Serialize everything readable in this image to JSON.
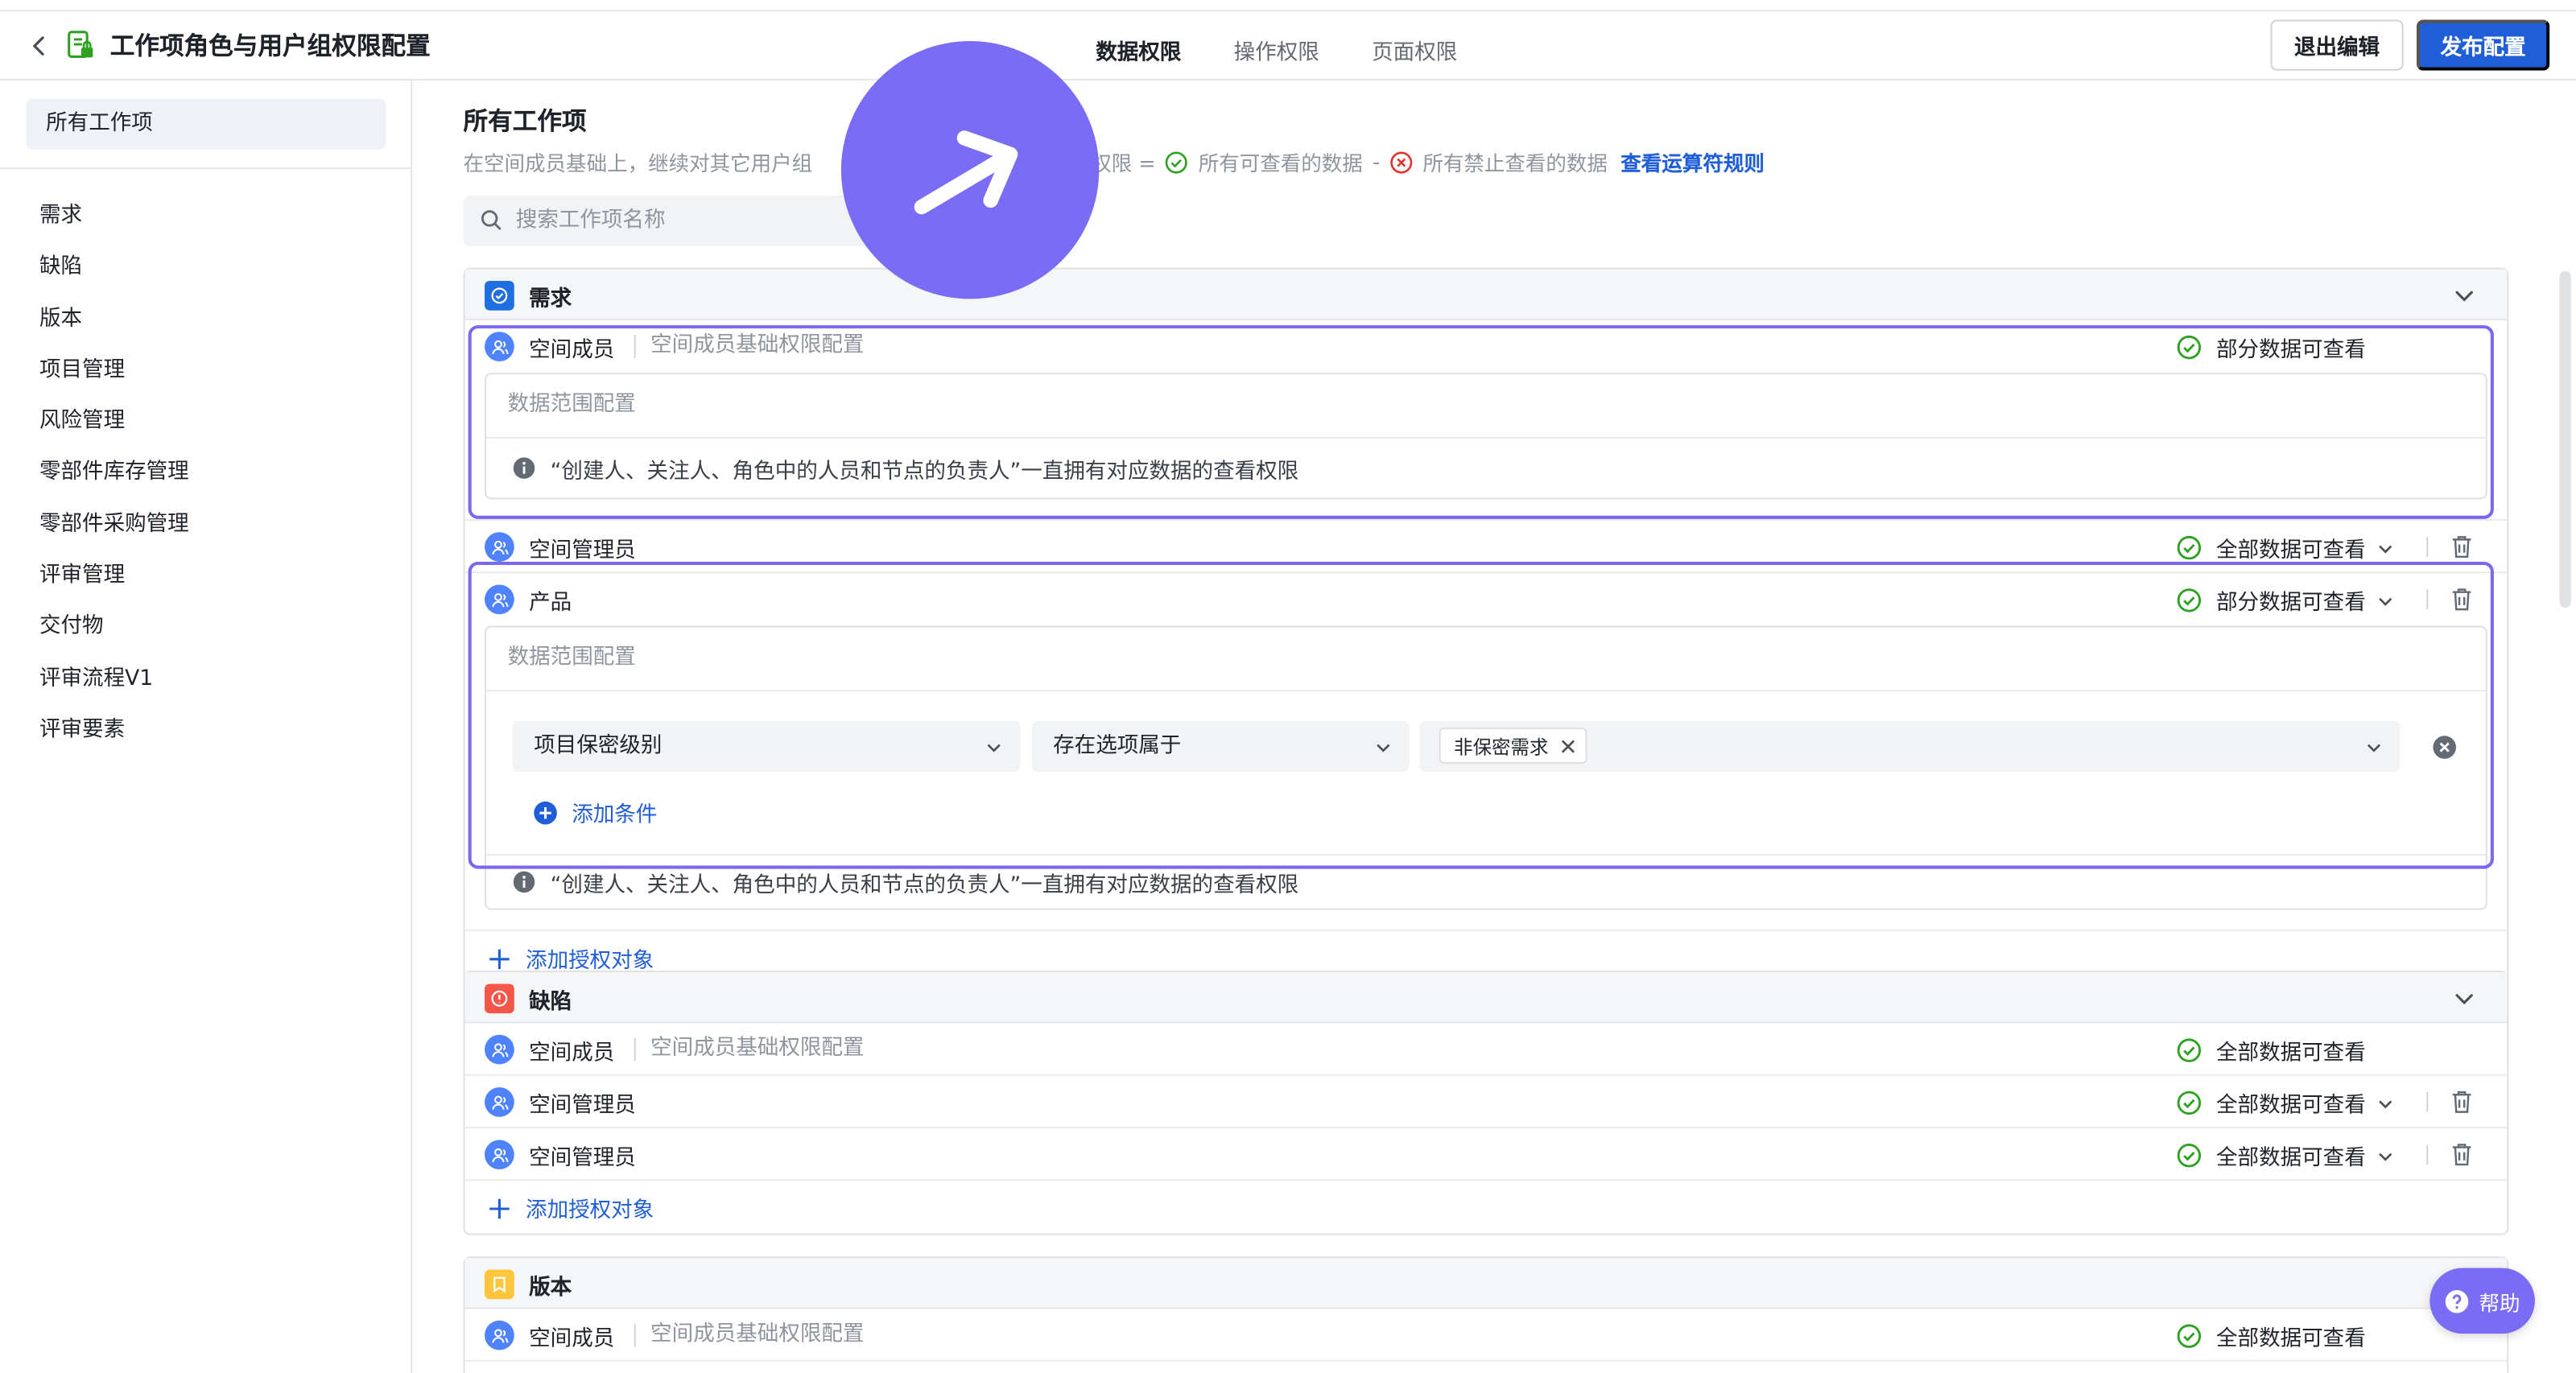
{
  "header": {
    "title": "工作项角色与用户组权限配置",
    "tabs": [
      {
        "label": "数据权限",
        "active": true
      },
      {
        "label": "操作权限",
        "active": false
      },
      {
        "label": "页面权限",
        "active": false
      }
    ],
    "exit_label": "退出编辑",
    "publish_label": "发布配置"
  },
  "sidebar": {
    "all_label": "所有工作项",
    "items": [
      "需求",
      "缺陷",
      "版本",
      "项目管理",
      "风险管理",
      "零部件库存管理",
      "零部件采购管理",
      "评审管理",
      "交付物",
      "评审流程V1",
      "评审要素"
    ]
  },
  "main": {
    "title": "所有工作项",
    "desc_prefix": "在空间成员基础上，继续对其它用户组",
    "desc_formula": "终权限 =",
    "desc_allowed": "所有可查看的数据",
    "desc_minus": "-",
    "desc_denied": "所有禁止查看的数据",
    "desc_link": "查看运算符规则",
    "search_placeholder": "搜索工作项名称"
  },
  "groups": {
    "req": {
      "name": "需求",
      "rows": {
        "member": {
          "name": "空间成员",
          "sub": "空间成员基础权限配置",
          "status": "部分数据可查看"
        },
        "admin": {
          "name": "空间管理员",
          "status": "全部数据可查看"
        },
        "product": {
          "name": "产品",
          "status": "部分数据可查看"
        }
      },
      "panel_title": "数据范围配置",
      "note": "“创建人、关注人、角色中的人员和节点的负责人”一直拥有对应数据的查看权限",
      "condition": {
        "field": "项目保密级别",
        "operator": "存在选项属于",
        "tag": "非保密需求"
      },
      "add_condition": "添加条件",
      "add_object": "添加授权对象"
    },
    "bug": {
      "name": "缺陷",
      "rows": {
        "member": {
          "name": "空间成员",
          "sub": "空间成员基础权限配置",
          "status": "全部数据可查看"
        },
        "admin1": {
          "name": "空间管理员",
          "status": "全部数据可查看"
        },
        "admin2": {
          "name": "空间管理员",
          "status": "全部数据可查看"
        }
      },
      "add_object": "添加授权对象"
    },
    "ver": {
      "name": "版本",
      "rows": {
        "member": {
          "name": "空间成员",
          "sub": "空间成员基础权限配置",
          "status": "全部数据可查看"
        }
      }
    }
  },
  "help_label": "帮助",
  "colors": {
    "accent": "#1f5ed8",
    "highlight": "#7b68ee",
    "success": "#2ea121",
    "danger": "#e0352b"
  }
}
